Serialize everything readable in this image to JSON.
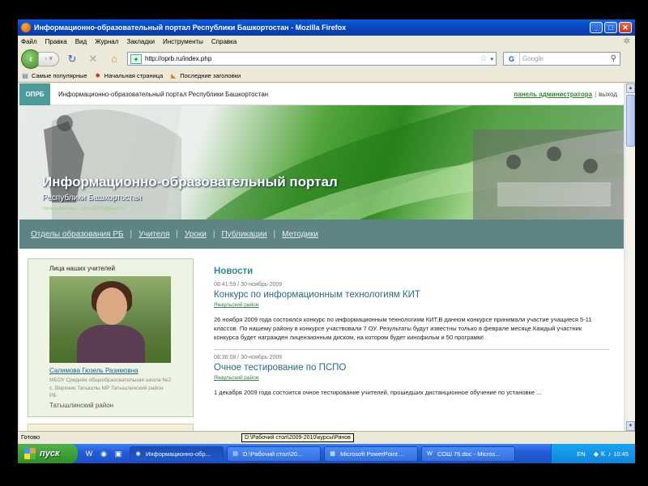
{
  "window": {
    "title": "Информационно-образовательный портал Республики Башкортостан - Mozilla Firefox",
    "min": "_",
    "max": "□",
    "close": "✕"
  },
  "menubar": [
    "Файл",
    "Правка",
    "Вид",
    "Журнал",
    "Закладки",
    "Инструменты",
    "Справка"
  ],
  "nav": {
    "url": "http://oprb.ru/index.php",
    "search_placeholder": "Google",
    "search_engine": "G"
  },
  "bookmarks": [
    "Самые популярные",
    "Начальная страница",
    "Последние заголовки"
  ],
  "site": {
    "logo": "ОПРБ",
    "top_title": "Информационно-образовательный портал Республики Башкортостан",
    "admin_link": "панель администратора",
    "logout": "выход",
    "banner_title": "Информационно-образовательный портал",
    "banner_sub": "Республики Башкортостан",
    "banner_small": "пользователь: ...dre.2007@mail.ru",
    "menu": [
      "Отделы образования РБ",
      "Учителя",
      "Уроки",
      "Публикации",
      "Методики"
    ],
    "teacher": {
      "caption": "Лица наших учителей",
      "name": "Салимова Гюзель Разимовна",
      "desc": "МБОУ Средняя общеобразовательная школа №2 с. Верхние Татышлы МР Татышлинский район РБ",
      "area": "Татышлинский район"
    },
    "news_heading": "Новости",
    "news": [
      {
        "meta": "08:41:59 / 30-ноябрь-2009",
        "title": "Конкурс по информационным технологиям КИТ",
        "source": "Янаульский район",
        "text": "26 ноября 2009 года состоялся конкурс по информационным технологиям КИТ.В данном конкурсе принимали участие учащиеся 5-11 классов. По нашему району в конкурсе участвовали 7 ОУ. Результаты будут известны только в феврале месяце.Каждый участник конкурса будет награжден лицензионным диском, на котором будет кинофильм и 50 программ!"
      },
      {
        "meta": "08:36:08 / 30-ноябрь-2009",
        "title": "Очное тестирование по ПСПО",
        "source": "Янаульский район",
        "text": "1 декабря 2009 года состоится очное тестирование учителей, прошедших дистанционное обучение по установке ..."
      }
    ]
  },
  "status": {
    "text": "Готово",
    "tooltip": "D:\\Рабочий стол\\2009-2010\\курсы\\Рянов"
  },
  "taskbar": {
    "start": "пуск",
    "tasks": [
      "Информационно-обр...",
      "D:\\Рабочий стол\\20...",
      "Microsoft PowerPoint ...",
      "СОШ 76.doc - Micros..."
    ],
    "lang": "EN",
    "time": "10:45"
  }
}
